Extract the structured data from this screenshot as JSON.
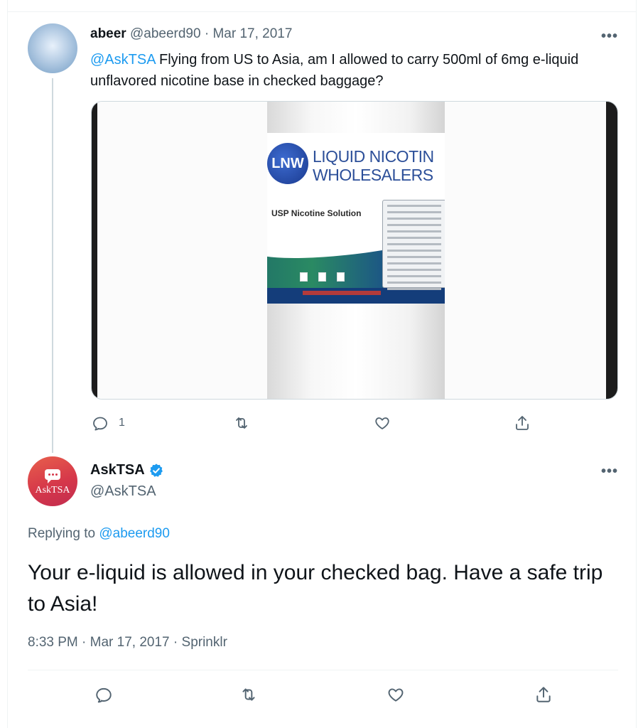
{
  "tweet1": {
    "name": "abeer",
    "handle": "@abeerd90",
    "separator": "·",
    "date": "Mar 17, 2017",
    "more": "•••",
    "mention": "@AskTSA",
    "text": " Flying from US to Asia, am I allowed to carry 500ml of 6mg e-liquid unflavored nicotine base in checked baggage?",
    "image": {
      "logo_text": "LNW",
      "brand_line1": "LIQUID NICOTIN",
      "brand_line2": "WHOLESALERS",
      "product": "USP Nicotine Solution"
    },
    "actions": {
      "reply_icon": "reply-icon",
      "reply_count": "1",
      "retweet_icon": "retweet-icon",
      "like_icon": "heart-icon",
      "share_icon": "share-icon"
    }
  },
  "tweet2": {
    "name": "AskTSA",
    "handle": "@AskTSA",
    "avatar_text": "AskTSA",
    "more": "•••",
    "replying_prefix": "Replying to ",
    "replying_handle": "@abeerd90",
    "text": "Your e-liquid is allowed in your checked bag. Have a safe trip to Asia!",
    "time": "8:33 PM",
    "date": "Mar 17, 2017",
    "source": "Sprinklr",
    "separator": "·"
  },
  "colors": {
    "link": "#1d9bf0",
    "muted": "#536471",
    "text": "#0f1419",
    "verified": "#1d9bf0"
  }
}
